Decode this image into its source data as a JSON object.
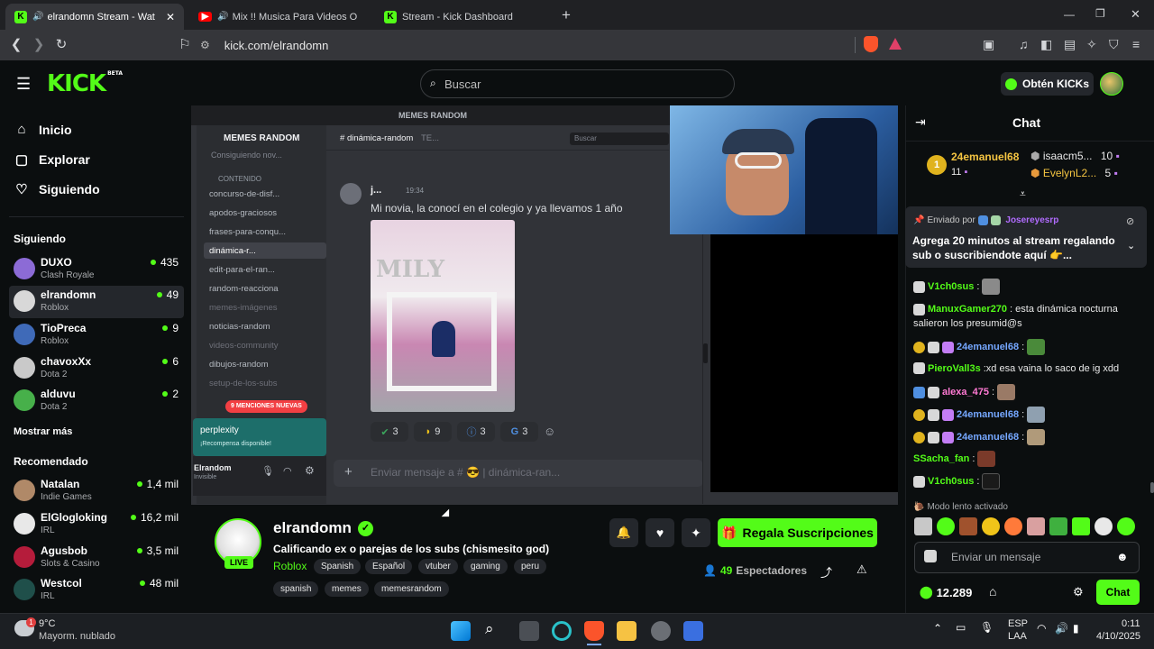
{
  "browser": {
    "tabs": [
      {
        "title": "elrandomn Stream - Watch Li",
        "active": true
      },
      {
        "title": "Mix !! Musica Para Videos O Para",
        "active": false
      },
      {
        "title": "Stream - Kick Dashboard",
        "active": false
      }
    ],
    "new_tab": "+",
    "url": "kick.com/elrandomn"
  },
  "header": {
    "logo": "KICK",
    "logo_beta": "BETA",
    "search_placeholder": "Buscar",
    "get_kicks": "Obtén KICKs"
  },
  "sidebar": {
    "nav": [
      {
        "icon": "home-icon",
        "label": "Inicio"
      },
      {
        "icon": "compass-icon",
        "label": "Explorar"
      },
      {
        "icon": "heart-icon",
        "label": "Siguiendo"
      }
    ],
    "following_title": "Siguiendo",
    "following": [
      {
        "name": "DUXO",
        "category": "Clash Royale",
        "viewers": "435"
      },
      {
        "name": "elrandomn",
        "category": "Roblox",
        "viewers": "49"
      },
      {
        "name": "TioPreca",
        "category": "Roblox",
        "viewers": "9"
      },
      {
        "name": "chavoxXx",
        "category": "Dota 2",
        "viewers": "6"
      },
      {
        "name": "alduvu",
        "category": "Dota 2",
        "viewers": "2"
      }
    ],
    "show_more": "Mostrar más",
    "recommended_title": "Recomendado",
    "recommended": [
      {
        "name": "Natalan",
        "category": "Indie Games",
        "viewers": "1,4 mil"
      },
      {
        "name": "ElGlogloking",
        "category": "IRL",
        "viewers": "16,2 mil"
      },
      {
        "name": "Agusbob",
        "category": "Slots & Casino",
        "viewers": "3,5 mil"
      },
      {
        "name": "Westcol",
        "category": "IRL",
        "viewers": "48 mil"
      }
    ]
  },
  "discord": {
    "window_title": "MEMES RANDOM",
    "server_name": "MEMES RANDOM",
    "channel_header": "dinámica-random",
    "channel_header_suffix": "TE...",
    "search": "Buscar",
    "onboarding": "Consiguiendo nov...",
    "category": "CONTENIDO",
    "channels": [
      "concurso-de-disf...",
      "apodos-graciosos",
      "frases-para-conqu...",
      "dinámica-r...",
      "edit-para-el-ran...",
      "random-reacciona",
      "memes-imágenes",
      "noticias-random",
      "videos-community",
      "dibujos-random",
      "setup-de-los-subs"
    ],
    "mentions_pill": "9 MENCIONES NUEVAS",
    "promo_title": "perplexity",
    "promo_sub": "¡Recompensa disponible!",
    "user_name": "Elrandom",
    "user_status": "Invisible",
    "msg_author": "j...",
    "msg_time": "19:34",
    "msg_text": "Mi novia, la conocí en el colegio y ya llevamos 1 año",
    "image_caption": "MILY",
    "reactions": [
      "3",
      "9",
      "3",
      "3"
    ],
    "input_placeholder": "Enviar mensaje a #",
    "input_channel": "dinámica-ran..."
  },
  "stream": {
    "streamer": "elrandomn",
    "live_label": "LIVE",
    "title": "Calificando ex o parejas de los subs (chismesito god)",
    "category": "Roblox",
    "tags_row1": [
      "Spanish",
      "Español",
      "vtuber",
      "gaming",
      "peru"
    ],
    "tags_row2": [
      "spanish",
      "memes",
      "memesrandom"
    ],
    "gift_button": "Regala Suscripciones",
    "viewers": "49",
    "viewers_label": "Espectadores"
  },
  "chat": {
    "title": "Chat",
    "leaderboard": [
      {
        "rank": "1",
        "name": "24emanuel68",
        "count": "11"
      },
      {
        "name": "isaacm5...",
        "count": "10"
      },
      {
        "name": "EvelynL2...",
        "count": "5"
      }
    ],
    "pinned_by_label": "Enviado por",
    "pinned_by": "Josereyesrp",
    "pinned_text": "Agrega 20 minutos al stream regalando sub o suscribiendote aquí 👉...",
    "messages": [
      {
        "user": "V1ch0sus",
        "text": "",
        "color": "#53fc18"
      },
      {
        "user": "ManuxGamer270",
        "text": "esta dinámica nocturna salieron los presumid@s",
        "color": "#53fc18"
      },
      {
        "user": "24emanuel68",
        "text": "",
        "color": "#75a7ff"
      },
      {
        "user": "PieroVall3s",
        "text": "xd esa vaina lo saco de ig xdd",
        "color": "#53fc18"
      },
      {
        "user": "alexa_475",
        "text": "",
        "color": "#ff79d3"
      },
      {
        "user": "24emanuel68",
        "text": "",
        "color": "#75a7ff"
      },
      {
        "user": "24emanuel68",
        "text": "",
        "color": "#75a7ff"
      },
      {
        "user": "SSacha_fan",
        "text": "",
        "color": "#53fc18"
      },
      {
        "user": "V1ch0sus",
        "text": "",
        "color": "#53fc18"
      }
    ],
    "slow_mode": "Modo lento activado",
    "input_placeholder": "Enviar un mensaje",
    "kicks_balance": "12.289",
    "send_button": "Chat"
  },
  "taskbar": {
    "weather_temp": "9°C",
    "weather_desc": "Mayorm. nublado",
    "weather_badge": "1",
    "lang1": "ESP",
    "lang2": "LAA",
    "time": "0:11",
    "date": "4/10/2025"
  },
  "colors": {
    "kick_green": "#53fc18",
    "page_bg": "#0b0e0f",
    "discord_bg": "#313338"
  }
}
